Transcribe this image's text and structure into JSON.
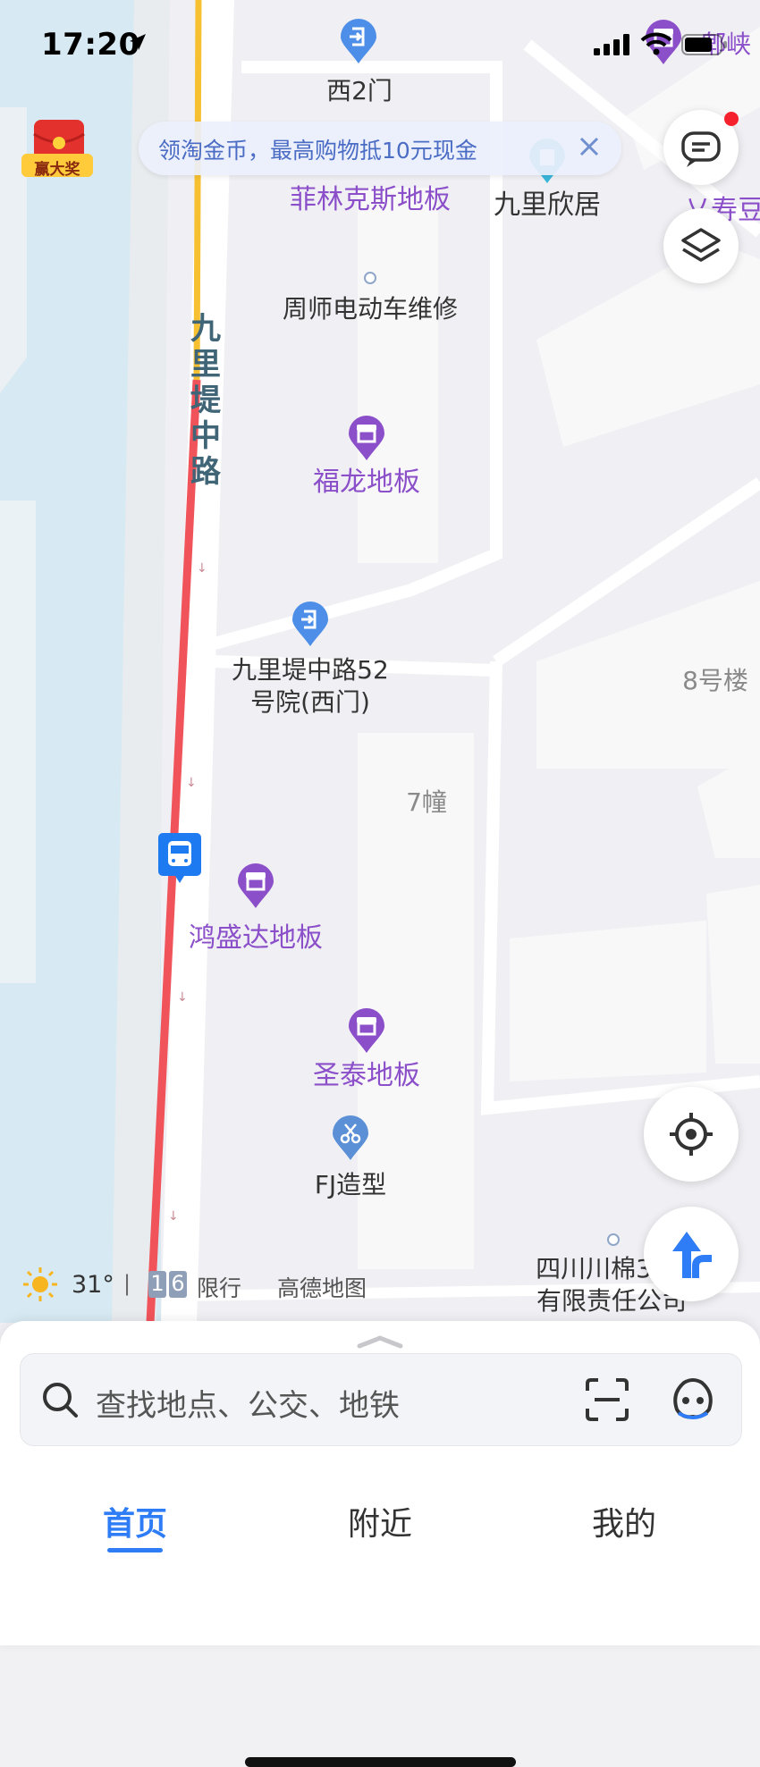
{
  "status_bar": {
    "time": "17:20"
  },
  "banner": {
    "text": "领淘金币，最高购物抵10元现金"
  },
  "gift": {
    "label": "赢大奖"
  },
  "map": {
    "road_name_chars": [
      "九",
      "里",
      "堤",
      "中",
      "路"
    ],
    "labels": {
      "west_gate_2": "西2门",
      "feilinkesi": "菲林克斯地板",
      "jiulixinju": "九里欣居",
      "zhoushi": "周师电动车维修",
      "fulong": "福龙地板",
      "yard_52_line1": "九里堤中路52",
      "yard_52_line2": "号院(西门)",
      "building_8": "8号楼",
      "building_7": "7幢",
      "hongshengda": "鸿盛达地板",
      "shengtai": "圣泰地板",
      "fj": "FJ造型",
      "sichuan_line1": "四川川棉3",
      "sichuan_line2": "有限责任公司",
      "top_right_partial": "郫峡",
      "right_partial": "乂寿豆"
    }
  },
  "weather": {
    "temp": "31°",
    "divider": "|",
    "plate_a": "1",
    "plate_b": "6",
    "restrict": "限行",
    "brand": "高德地图"
  },
  "search": {
    "placeholder": "查找地点、公交、地铁"
  },
  "tabs": [
    {
      "label": "首页",
      "active": true
    },
    {
      "label": "附近",
      "active": false
    },
    {
      "label": "我的",
      "active": false
    }
  ],
  "colors": {
    "accent": "#2e7cf6",
    "poi_purple": "#8b4fc9",
    "traffic_red": "#f0545a",
    "traffic_yellow": "#f6c030",
    "water": "#d7e9f2"
  }
}
